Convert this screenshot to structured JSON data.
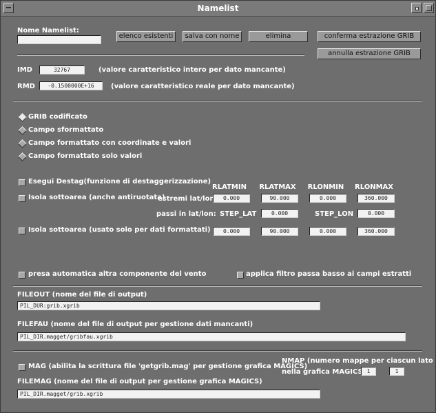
{
  "window": {
    "title": "Namelist"
  },
  "namelist": {
    "label": "Nome Namelist:",
    "value": "",
    "buttons": [
      "elenco esistenti",
      "salva con nome",
      "elimina",
      "conferma estrazione GRIB",
      "annulla estrazione GRIB"
    ]
  },
  "imd": {
    "label": "IMD",
    "value": "32767",
    "desc": "(valore caratteristico intero per dato mancante)"
  },
  "rmd": {
    "label": "RMD",
    "value": "-0.1500000E+16",
    "desc": "(valore caratteristico reale per dato mancante)"
  },
  "radios": {
    "selected": 0,
    "items": [
      "GRIB codificato",
      "Campo sformattato",
      "Campo formattato con coordinate e valori",
      "Campo formattato solo valori"
    ]
  },
  "destag": {
    "label": "Esegui Destag(funzione di destaggerizzazione)"
  },
  "columns": [
    "RLATMIN",
    "RLATMAX",
    "RLONMIN",
    "RLONMAX"
  ],
  "isola1": {
    "label": "Isola sottoarea (anche antiruotata)",
    "estremi_label": "estremi lat/lon:",
    "values": [
      "0.000",
      "90.000",
      "0.000",
      "360.000"
    ],
    "passi_label": "passi in lat/lon:",
    "step_lat_label": "STEP_LAT",
    "step_lat": "0.000",
    "step_lon_label": "STEP_LON",
    "step_lon": "0.000"
  },
  "isola2": {
    "label": "Isola sottoarea (usato solo per dati formattati)",
    "values": [
      "0.000",
      "90.000",
      "0.000",
      "360.000"
    ]
  },
  "options": {
    "vento": "presa automatica altra componente del vento",
    "filtro": "applica filtro passa basso ai campi estratti"
  },
  "fileout": {
    "label": "FILEOUT  (nome del file di output)",
    "value": "PIL_DUR:grib.xgrib"
  },
  "filefau": {
    "label": "FILEFAU  (nome del file di output per gestione dati mancanti)",
    "value": "PIL_DIR.magget/gribfau.xgrib"
  },
  "mag": {
    "label": "MAG (abilita la scrittura file 'getgrib.mag' per gestione grafica MAGICS)"
  },
  "nmap": {
    "label1": "NMAP (numero mappe per ciascun lato",
    "label2": "nella grafica MAGICS):",
    "values": [
      "1",
      "1"
    ]
  },
  "filemag": {
    "label": "FILEMAG  (nome del file di output per gestione grafica MAGICS)",
    "value": "PIL_DIR.magget/grib.xgrib"
  }
}
